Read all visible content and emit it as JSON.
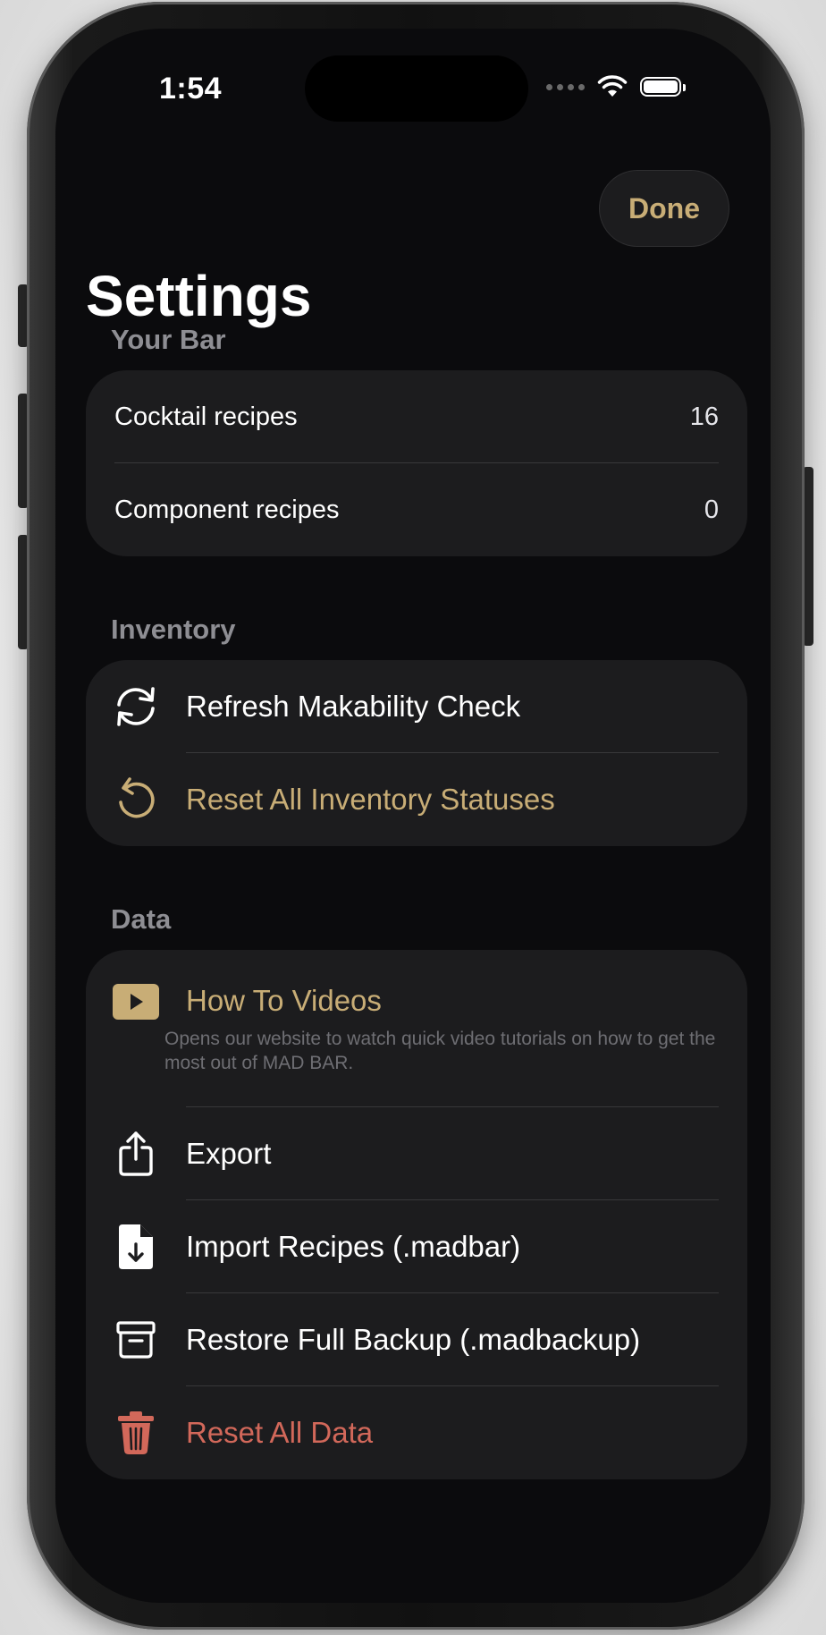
{
  "status_bar": {
    "time": "1:54"
  },
  "nav": {
    "done_label": "Done",
    "title": "Settings"
  },
  "your_bar": {
    "header": "Your Bar",
    "rows": [
      {
        "label": "Cocktail recipes",
        "value": "16"
      },
      {
        "label": "Component recipes",
        "value": "0"
      }
    ]
  },
  "inventory": {
    "header": "Inventory",
    "refresh_label": "Refresh Makability Check",
    "refresh_icon": "arrow-circle-icon",
    "reset_label": "Reset All Inventory Statuses",
    "reset_icon": "counterclockwise-arrow-icon"
  },
  "data_section": {
    "header": "Data",
    "videos_title": "How To Videos",
    "videos_desc": "Opens our website to watch quick video tutorials on how to get the most out of MAD BAR.",
    "videos_icon": "play-rectangle-icon",
    "export_label": "Export",
    "export_icon": "share-icon",
    "import_label": "Import Recipes (.madbar)",
    "import_icon": "document-download-icon",
    "restore_label": "Restore Full Backup (.madbackup)",
    "restore_icon": "archive-box-icon",
    "reset_label": "Reset All Data",
    "reset_icon": "trash-icon"
  },
  "colors": {
    "accent_gold": "#c8ad76",
    "destructive_red": "#d2685a",
    "background": "#0b0b0d",
    "card": "#1c1c1e",
    "secondary_text": "#8e8e93"
  }
}
